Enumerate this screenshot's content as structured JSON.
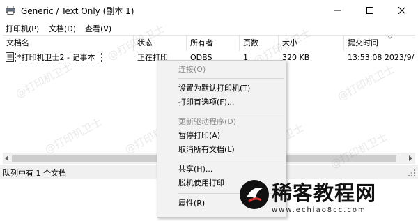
{
  "window": {
    "title": "Generic / Text Only (副本 1)",
    "buttons": {
      "minimize": "—",
      "maximize": "☐",
      "close": "✕"
    }
  },
  "menu": [
    "打印机(P)",
    "文档(D)",
    "查看(V)"
  ],
  "columns": [
    "文档名",
    "状态",
    "所有者",
    "页数",
    "大小",
    "提交时间"
  ],
  "rows": [
    {
      "name": "*打印机卫士2 - 记事本",
      "status": "正在打印",
      "owner": "ODBS",
      "pages": "1",
      "size": "320 KB",
      "time": "13:53:08  2023/9/"
    }
  ],
  "status_bar": "队列中有 1 个文档",
  "context_menu": {
    "items": [
      {
        "label": "连接(O)",
        "enabled": false
      },
      {
        "label": "设置为默认打印机(T)",
        "enabled": true
      },
      {
        "label": "打印首选项(F)...",
        "enabled": true
      },
      {
        "label": "更新驱动程序(D)",
        "enabled": false
      },
      {
        "label": "暂停打印(A)",
        "enabled": true
      },
      {
        "label": "取消所有文档(L)",
        "enabled": true
      },
      {
        "label": "共享(H)...",
        "enabled": true
      },
      {
        "label": "脱机使用打印",
        "enabled": true
      },
      {
        "label": "属性(R)",
        "enabled": true
      }
    ]
  },
  "watermark": "@打印机卫士",
  "logo": {
    "name": "稀客教程网",
    "url": "www.echiao8cc.com"
  },
  "colors": {
    "accent": "#0078d7",
    "menu_bg": "#f2f2f2",
    "disabled_text": "#8c8c8c"
  }
}
